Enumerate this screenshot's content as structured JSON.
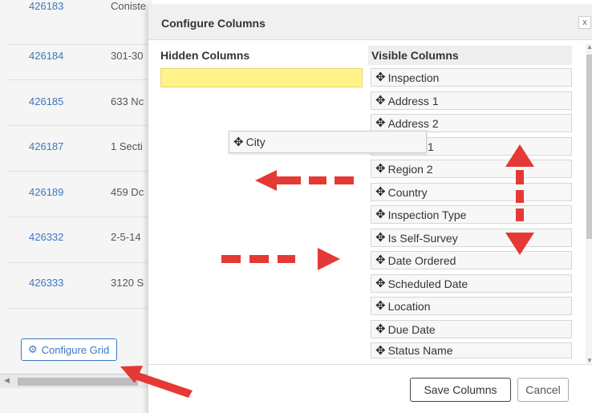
{
  "background_grid": {
    "rows": [
      {
        "id": "426183",
        "address": "Coniste"
      },
      {
        "id": "426184",
        "address": "301-30"
      },
      {
        "id": "426185",
        "address": "633 Nc"
      },
      {
        "id": "426187",
        "address": "1 Secti"
      },
      {
        "id": "426189",
        "address": "459 Dc"
      },
      {
        "id": "426332",
        "address": "2-5-14"
      },
      {
        "id": "426333",
        "address": "3120 S"
      }
    ],
    "configure_grid_label": "Configure Grid"
  },
  "modal": {
    "title": "Configure Columns",
    "close_label": "x",
    "hidden_heading": "Hidden Columns",
    "visible_heading": "Visible Columns",
    "visible_columns": [
      "Inspection",
      "Address 1",
      "Address 2",
      "1",
      "Region 2",
      "Country",
      "Inspection Type",
      "Is Self-Survey",
      "Date Ordered",
      "Scheduled Date",
      "Location",
      "Due Date",
      "Status Name"
    ],
    "dragging_item": "City",
    "save_label": "Save Columns",
    "cancel_label": "Cancel"
  },
  "colors": {
    "link": "#3a78c0",
    "drop_highlight": "#fff38a",
    "annotation_arrow": "#e53935"
  },
  "icons": {
    "move": "move-icon",
    "gear": "gear-icon",
    "close": "close-icon"
  }
}
